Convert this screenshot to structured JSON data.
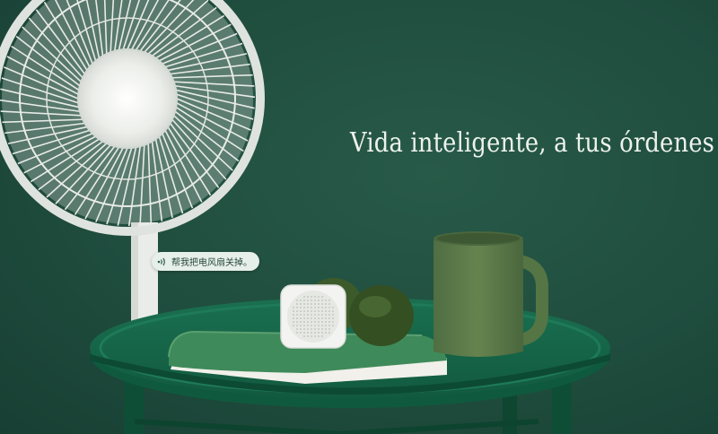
{
  "headline": "Vida inteligente, a tus órdenes",
  "voice_command": {
    "icon": "voice-wave-icon",
    "text": "帮我把电风扇关掉。"
  },
  "colors": {
    "background": "#1f4d3e",
    "table": "#17664a",
    "bubble": "#e6efe9",
    "headline_text": "#eef2ee"
  }
}
